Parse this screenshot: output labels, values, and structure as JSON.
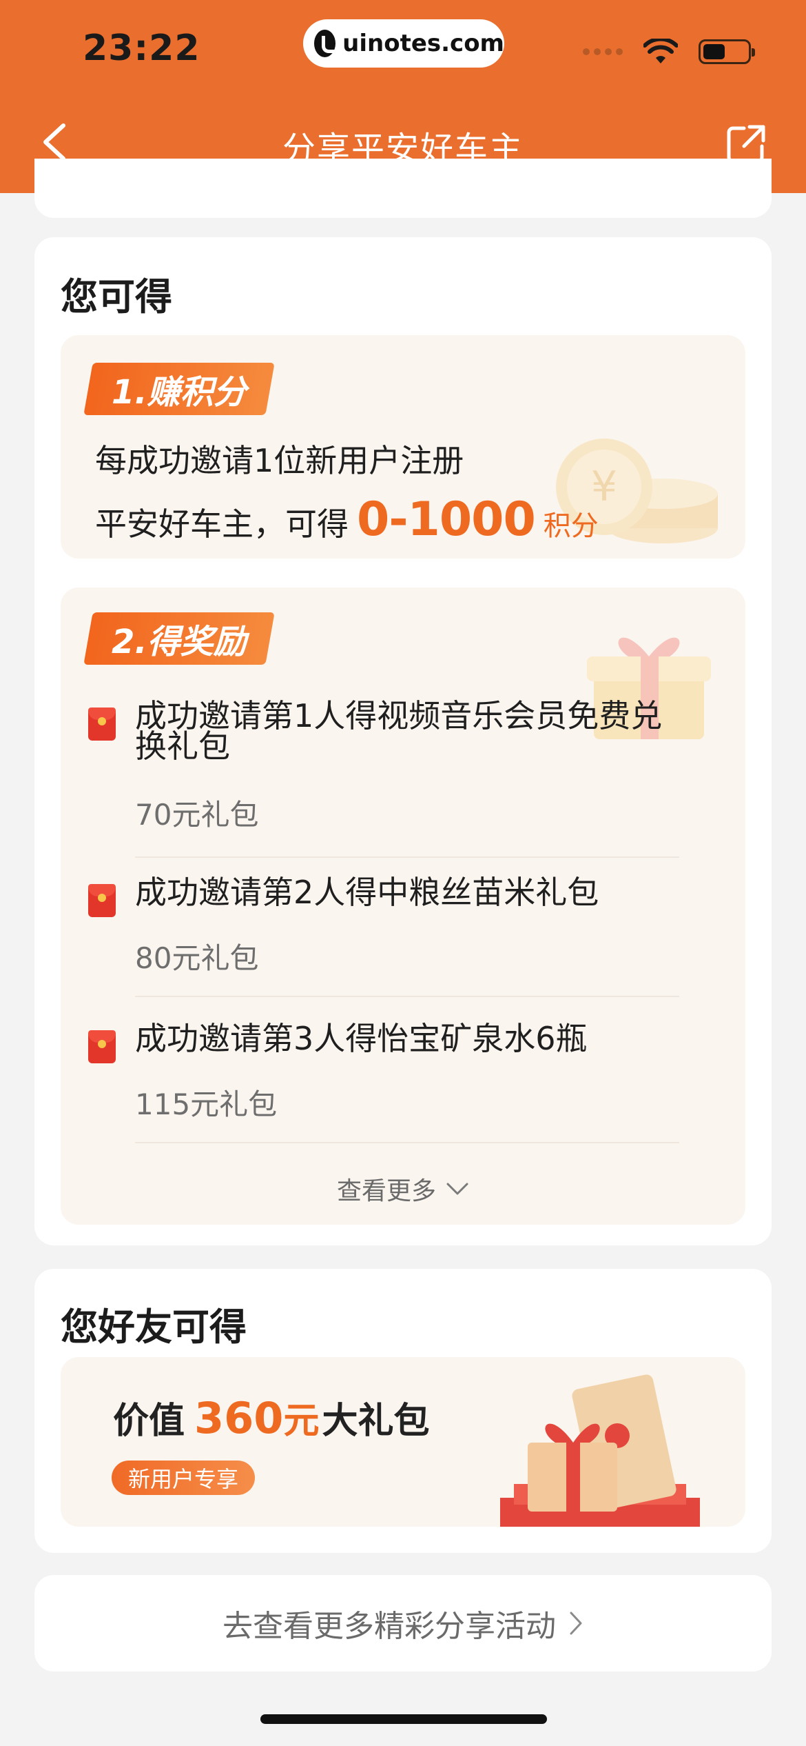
{
  "status_bar": {
    "time": "23:22",
    "url": "uinotes.com"
  },
  "nav": {
    "title": "分享平安好车主"
  },
  "you_get": {
    "title": "您可得",
    "points": {
      "tag": "1.赚积分",
      "line1": "每成功邀请1位新用户注册",
      "line2_prefix": "平安好车主，可得",
      "value": "0-1000",
      "unit": "积分"
    },
    "rewards": {
      "tag": "2.得奖励",
      "items": [
        {
          "title": "成功邀请第1人得视频音乐会员免费兑换礼包",
          "value": "70元礼包"
        },
        {
          "title": "成功邀请第2人得中粮丝苗米礼包",
          "value": "80元礼包"
        },
        {
          "title": "成功邀请第3人得怡宝矿泉水6瓶",
          "value": "115元礼包"
        }
      ],
      "see_more": "查看更多"
    }
  },
  "friend_gets": {
    "title": "您好友可得",
    "prefix": "价值",
    "value": "360",
    "unit": "元",
    "suffix": "大礼包",
    "tag": "新用户专享"
  },
  "footer_link": {
    "label": "去查看更多精彩分享活动"
  },
  "colors": {
    "primary": "#ea6f2e",
    "accent": "#ef6a21",
    "card_bg": "#fbf5ef"
  }
}
